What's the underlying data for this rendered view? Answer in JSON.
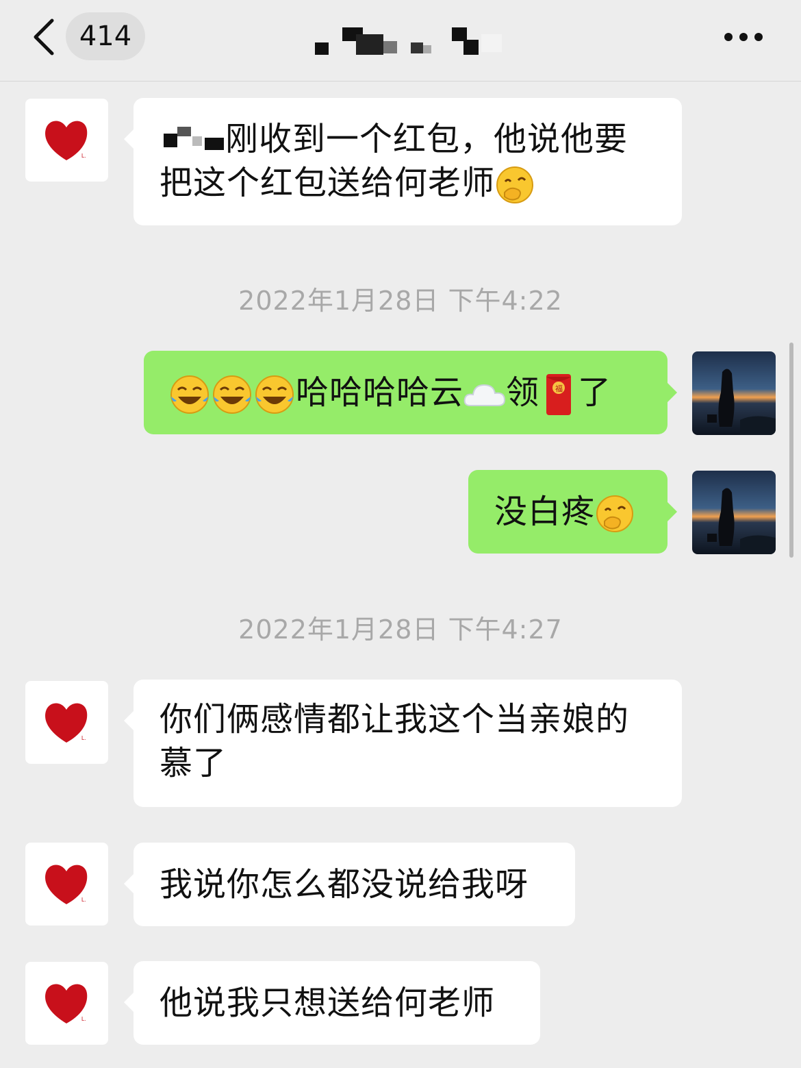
{
  "header": {
    "back_icon": "chevron-left-icon",
    "unread_count": "414",
    "more_icon": "more-dots-icon"
  },
  "messages": [
    {
      "side": "left",
      "avatar": "red-heart-avatar",
      "text_line1": "刚收到一个红包，他说他要",
      "text_line2": "把这个红包送给何老师",
      "emoji": "covering-mouth-emoji"
    },
    {
      "timestamp": "2022年1月28日 下午4:22"
    },
    {
      "side": "right",
      "avatar": "sunset-silhouette-avatar",
      "text_a": "哈哈哈哈云",
      "text_b": "领",
      "text_c": "了",
      "emojis": [
        "tears-of-joy-emoji",
        "tears-of-joy-emoji",
        "tears-of-joy-emoji",
        "cloud-emoji",
        "red-envelope-emoji"
      ]
    },
    {
      "side": "right",
      "avatar": "sunset-silhouette-avatar",
      "text": "没白疼",
      "emoji": "covering-mouth-emoji"
    },
    {
      "timestamp": "2022年1月28日 下午4:27"
    },
    {
      "side": "left",
      "avatar": "red-heart-avatar",
      "text_line1": "你们俩感情都让我这个当亲娘的",
      "text_line2": "慕了"
    },
    {
      "side": "left",
      "avatar": "red-heart-avatar",
      "text": "我说你怎么都没说给我呀"
    },
    {
      "side": "left",
      "avatar": "red-heart-avatar",
      "text": "他说我只想送给何老师"
    }
  ],
  "colors": {
    "background": "#ededed",
    "incoming_bubble": "#ffffff",
    "outgoing_bubble": "#95ec69",
    "timestamp": "#a8a8a8",
    "heart": "#c8101b"
  }
}
